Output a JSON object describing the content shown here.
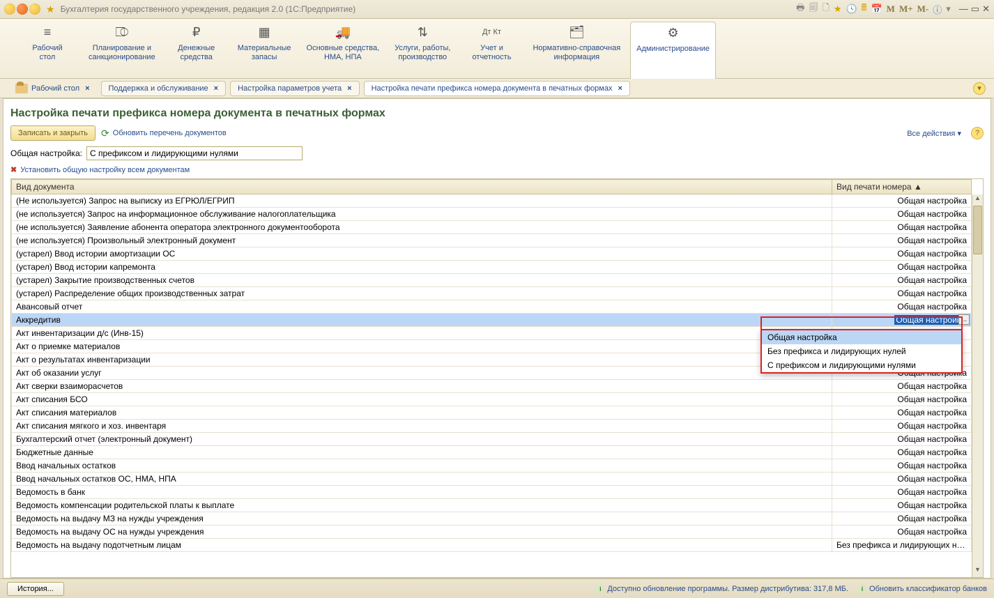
{
  "window": {
    "title": "Бухгалтерия государственного учреждения, редакция 2.0  (1С:Предприятие)"
  },
  "titleicons": {
    "m": "M",
    "mplus": "M+",
    "mminus": "M-"
  },
  "nav": [
    {
      "label": "Рабочий\nстол"
    },
    {
      "label": "Планирование и\nсанкционирование"
    },
    {
      "label": "Денежные\nсредства"
    },
    {
      "label": "Материальные\nзапасы"
    },
    {
      "label": "Основные средства,\nНМА, НПА"
    },
    {
      "label": "Услуги, работы,\nпроизводство"
    },
    {
      "label": "Учет и\nотчетность"
    },
    {
      "label": "Нормативно-справочная\nинформация"
    },
    {
      "label": "Администрирование"
    }
  ],
  "tabs": {
    "desktop": "Рабочий стол",
    "t1": "Поддержка и обслуживание",
    "t2": "Настройка параметров учета",
    "t3": "Настройка печати префикса номера документа в печатных формах"
  },
  "page": {
    "header": "Настройка печати префикса номера документа в печатных формах",
    "saveclose": "Записать и закрыть",
    "refresh": "Обновить перечень документов",
    "allactions": "Все действия",
    "general_label": "Общая настройка:",
    "general_value": "С префиксом и лидирующими нулями",
    "apply_all": "Установить общую настройку всем документам"
  },
  "table": {
    "col1": "Вид документа",
    "col2": "Вид печати номера",
    "rows": [
      {
        "doc": "(Не используется) Запрос на выписку из ЕГРЮЛ/ЕГРИП",
        "val": "Общая настройка"
      },
      {
        "doc": "(не используется) Запрос на информационное обслуживание налогоплательщика",
        "val": "Общая настройка"
      },
      {
        "doc": "(не используется) Заявление абонента оператора электронного документооборота",
        "val": "Общая настройка"
      },
      {
        "doc": "(не используется) Произвольный электронный документ",
        "val": "Общая настройка"
      },
      {
        "doc": "(устарел) Ввод истории амортизации ОС",
        "val": "Общая настройка"
      },
      {
        "doc": "(устарел) Ввод истории капремонта",
        "val": "Общая настройка"
      },
      {
        "doc": "(устарел) Закрытие производственных счетов",
        "val": "Общая настройка"
      },
      {
        "doc": "(устарел) Распределение общих производственных затрат",
        "val": "Общая настройка"
      },
      {
        "doc": "Авансовый отчет",
        "val": "Общая настройка"
      },
      {
        "doc": "Аккредитив",
        "val": "Общая настройка",
        "selected": true
      },
      {
        "doc": "Акт инвентаризации д/с (Инв-15)",
        "val": ""
      },
      {
        "doc": "Акт о приемке материалов",
        "val": ""
      },
      {
        "doc": "Акт о результатах инвентаризации",
        "val": ""
      },
      {
        "doc": "Акт об оказании услуг",
        "val": "Общая настройка"
      },
      {
        "doc": "Акт сверки взаиморасчетов",
        "val": "Общая настройка"
      },
      {
        "doc": "Акт списания БСО",
        "val": "Общая настройка"
      },
      {
        "doc": "Акт списания материалов",
        "val": "Общая настройка"
      },
      {
        "doc": "Акт списания мягкого и хоз. инвентаря",
        "val": "Общая настройка"
      },
      {
        "doc": "Бухгалтерский отчет (электронный документ)",
        "val": "Общая настройка"
      },
      {
        "doc": "Бюджетные данные",
        "val": "Общая настройка"
      },
      {
        "doc": "Ввод начальных остатков",
        "val": "Общая настройка"
      },
      {
        "doc": "Ввод начальных остатков ОС, НМА, НПА",
        "val": "Общая настройка"
      },
      {
        "doc": "Ведомость в банк",
        "val": "Общая настройка"
      },
      {
        "doc": "Ведомость компенсации родительской платы к выплате",
        "val": "Общая настройка"
      },
      {
        "doc": "Ведомость на выдачу МЗ на нужды учреждения",
        "val": "Общая настройка"
      },
      {
        "doc": "Ведомость на выдачу ОС на нужды учреждения",
        "val": "Общая настройка"
      },
      {
        "doc": "Ведомость на выдачу подотчетным лицам",
        "val": "Без префикса и лидирующих нулей"
      }
    ]
  },
  "dropdown": {
    "opt1": "Общая настройка",
    "opt2": "Без префикса и лидирующих нулей",
    "opt3": "С префиксом и лидирующими нулями"
  },
  "status": {
    "history": "История...",
    "update": "Доступно обновление программы. Размер дистрибутива: 317,8 МБ.",
    "classifier": "Обновить классификатор банков"
  },
  "misc": {
    "dots": "...",
    "x": "×",
    "dash": "–",
    "sq": "▫",
    "tri": "▾"
  }
}
